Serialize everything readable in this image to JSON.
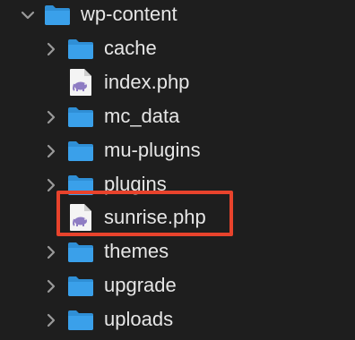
{
  "tree": {
    "root": {
      "name": "wp-content",
      "expanded": true,
      "type": "folder"
    },
    "children": [
      {
        "name": "cache",
        "type": "folder",
        "expandable": true
      },
      {
        "name": "index.php",
        "type": "php-file",
        "expandable": false
      },
      {
        "name": "mc_data",
        "type": "folder",
        "expandable": true
      },
      {
        "name": "mu-plugins",
        "type": "folder",
        "expandable": true
      },
      {
        "name": "plugins",
        "type": "folder",
        "expandable": true
      },
      {
        "name": "sunrise.php",
        "type": "php-file",
        "expandable": false,
        "highlighted": true
      },
      {
        "name": "themes",
        "type": "folder",
        "expandable": true
      },
      {
        "name": "upgrade",
        "type": "folder",
        "expandable": true
      },
      {
        "name": "uploads",
        "type": "folder",
        "expandable": true
      }
    ]
  },
  "colors": {
    "background": "#1e1e1e",
    "text": "#e6e6e6",
    "folder": "#3aa0ea",
    "highlight_box": "#e8432c",
    "php_badge": "#8e7cc3"
  },
  "icons": {
    "folder": "folder-icon",
    "php_file": "php-file-icon",
    "chevron_right": "chevron-right-icon",
    "chevron_down": "chevron-down-icon"
  }
}
